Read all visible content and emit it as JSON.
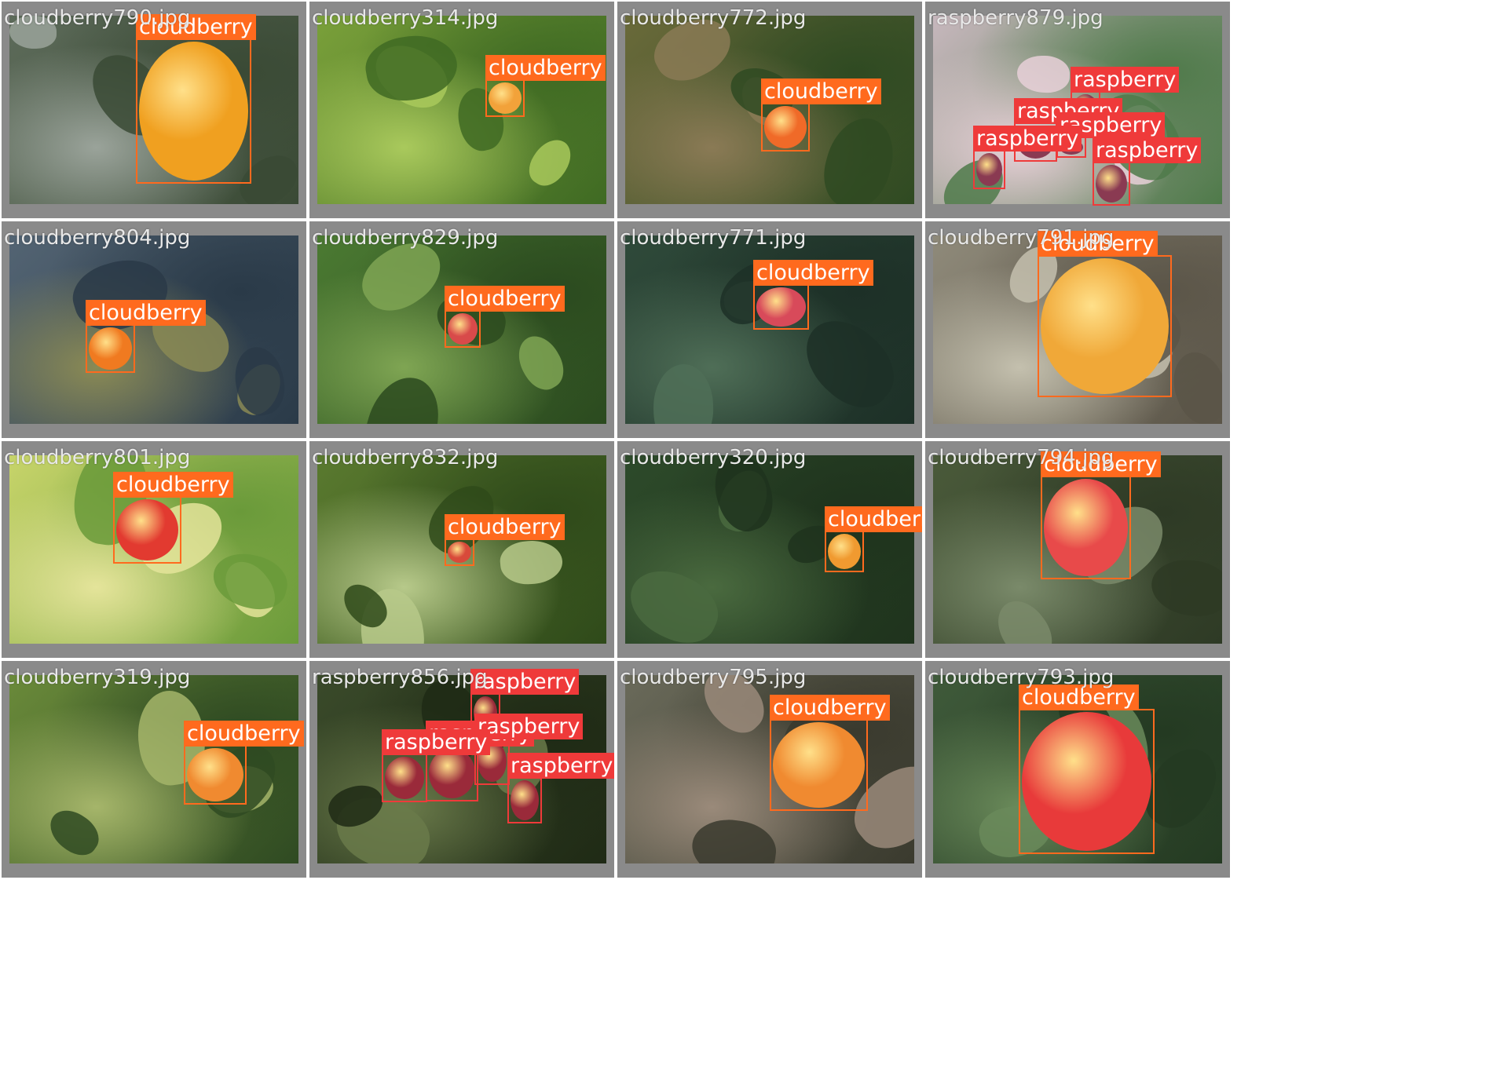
{
  "title": "",
  "colors": {
    "cloudberry_box": "#ff6a1e",
    "raspberry_box": "#ef3a3a",
    "label_text": "#ffffff",
    "filename_text": "#e8e8e8",
    "tile_frame": "#8a8a8a"
  },
  "tiles": [
    {
      "filename": "cloudberry790.jpg",
      "background": [
        "#5d6b5a",
        "#3a4a35",
        "#9aa39a"
      ],
      "detections": [
        {
          "label": "cloudberry"
        }
      ]
    },
    {
      "filename": "cloudberry314.jpg",
      "background": [
        "#7aa03a",
        "#3f6a23",
        "#a9c95c"
      ],
      "detections": [
        {
          "label": "cloudberry"
        }
      ]
    },
    {
      "filename": "cloudberry772.jpg",
      "background": [
        "#6a6a3a",
        "#2f4a22",
        "#8a7a55"
      ],
      "detections": [
        {
          "label": "cloudberry"
        }
      ]
    },
    {
      "filename": "raspberry879.jpg",
      "background": [
        "#c7b7bd",
        "#4f7a4a",
        "#e8d0d8"
      ],
      "detections": [
        {
          "label": "raspberry"
        },
        {
          "label": "raspberry"
        },
        {
          "label": "raspberry"
        },
        {
          "label": "raspberry"
        },
        {
          "label": "raspberry"
        }
      ]
    },
    {
      "filename": "cloudberry804.jpg",
      "background": [
        "#536473",
        "#2a3a48",
        "#8a8a55"
      ],
      "detections": [
        {
          "label": "cloudberry"
        }
      ]
    },
    {
      "filename": "cloudberry829.jpg",
      "background": [
        "#4b7a32",
        "#2b4a1f",
        "#7fa553"
      ],
      "detections": [
        {
          "label": "cloudberry"
        }
      ]
    },
    {
      "filename": "cloudberry771.jpg",
      "background": [
        "#2f4a3a",
        "#1d3027",
        "#4f6e57"
      ],
      "detections": [
        {
          "label": "cloudberry"
        }
      ]
    },
    {
      "filename": "cloudberry791.jpg",
      "background": [
        "#8f8a7a",
        "#5b5548",
        "#c4c0ae"
      ],
      "detections": [
        {
          "label": "cloudberry"
        }
      ]
    },
    {
      "filename": "cloudberry801.jpg",
      "background": [
        "#c7d46a",
        "#6a9a3a",
        "#e4e49a"
      ],
      "detections": [
        {
          "label": "cloudberry"
        }
      ]
    },
    {
      "filename": "cloudberry832.jpg",
      "background": [
        "#5a7a2f",
        "#2f4a1a",
        "#b7c98a"
      ],
      "detections": [
        {
          "label": "cloudberry"
        }
      ]
    },
    {
      "filename": "cloudberry320.jpg",
      "background": [
        "#2d4a2a",
        "#1f331d",
        "#4a6a3f"
      ],
      "detections": [
        {
          "label": "cloudberry"
        }
      ]
    },
    {
      "filename": "cloudberry794.jpg",
      "background": [
        "#4a5a3a",
        "#2e3a25",
        "#7a8a6a"
      ],
      "detections": [
        {
          "label": "cloudberry"
        }
      ]
    },
    {
      "filename": "cloudberry319.jpg",
      "background": [
        "#6a8a3a",
        "#2f4a22",
        "#a5b56a"
      ],
      "detections": [
        {
          "label": "cloudberry"
        }
      ]
    },
    {
      "filename": "raspberry856.jpg",
      "background": [
        "#3a4a2a",
        "#1f2a15",
        "#6a7a4a"
      ],
      "detections": [
        {
          "label": "raspberry"
        },
        {
          "label": "raspberry"
        },
        {
          "label": "raspberry"
        },
        {
          "label": "raspberry"
        },
        {
          "label": "raspberry"
        }
      ]
    },
    {
      "filename": "cloudberry795.jpg",
      "background": [
        "#6a6a5a",
        "#3a3a2e",
        "#9a8a7a"
      ],
      "detections": [
        {
          "label": "cloudberry"
        }
      ]
    },
    {
      "filename": "cloudberry793.jpg",
      "background": [
        "#3f5a3a",
        "#243a22",
        "#6a8a5a"
      ],
      "detections": [
        {
          "label": "cloudberry"
        }
      ]
    }
  ]
}
